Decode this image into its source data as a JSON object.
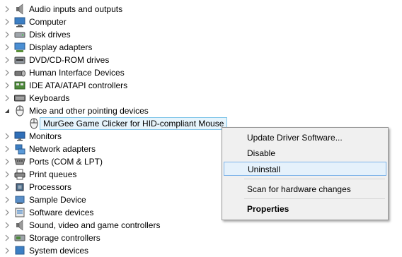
{
  "tree": {
    "items": [
      {
        "label": "Audio inputs and outputs",
        "icon": "speaker-icon",
        "expanded": false
      },
      {
        "label": "Computer",
        "icon": "computer-icon",
        "expanded": false
      },
      {
        "label": "Disk drives",
        "icon": "disk-drive-icon",
        "expanded": false
      },
      {
        "label": "Display adapters",
        "icon": "display-adapter-icon",
        "expanded": false
      },
      {
        "label": "DVD/CD-ROM drives",
        "icon": "dvd-drive-icon",
        "expanded": false
      },
      {
        "label": "Human Interface Devices",
        "icon": "hid-icon",
        "expanded": false
      },
      {
        "label": "IDE ATA/ATAPI controllers",
        "icon": "ide-controller-icon",
        "expanded": false
      },
      {
        "label": "Keyboards",
        "icon": "keyboard-icon",
        "expanded": false
      },
      {
        "label": "Mice and other pointing devices",
        "icon": "mouse-icon",
        "expanded": true
      },
      {
        "label": "Monitors",
        "icon": "monitor-icon",
        "expanded": false
      },
      {
        "label": "Network adapters",
        "icon": "network-adapter-icon",
        "expanded": false
      },
      {
        "label": "Ports (COM & LPT)",
        "icon": "port-icon",
        "expanded": false
      },
      {
        "label": "Print queues",
        "icon": "printer-icon",
        "expanded": false
      },
      {
        "label": "Processors",
        "icon": "processor-icon",
        "expanded": false
      },
      {
        "label": "Sample Device",
        "icon": "sample-device-icon",
        "expanded": false
      },
      {
        "label": "Software devices",
        "icon": "software-device-icon",
        "expanded": false
      },
      {
        "label": "Sound, video and game controllers",
        "icon": "sound-controller-icon",
        "expanded": false
      },
      {
        "label": "Storage controllers",
        "icon": "storage-controller-icon",
        "expanded": false
      },
      {
        "label": "System devices",
        "icon": "system-device-icon",
        "expanded": false
      }
    ],
    "selected_child": {
      "label": "MurGee Game Clicker for HID-compliant Mouse",
      "icon": "mouse-icon"
    }
  },
  "context_menu": {
    "items": [
      {
        "label": "Update Driver Software..."
      },
      {
        "label": "Disable"
      },
      {
        "label": "Uninstall",
        "highlighted": true
      },
      {
        "label": "Scan for hardware changes"
      },
      {
        "label": "Properties",
        "bold": true
      }
    ]
  },
  "colors": {
    "selection_border": "#7ec4e8",
    "selection_fill": "#e6f4fc",
    "menu_background": "#f0f0f0",
    "menu_highlight": "#e5f1fb",
    "menu_highlight_border": "#7eb4ea"
  }
}
